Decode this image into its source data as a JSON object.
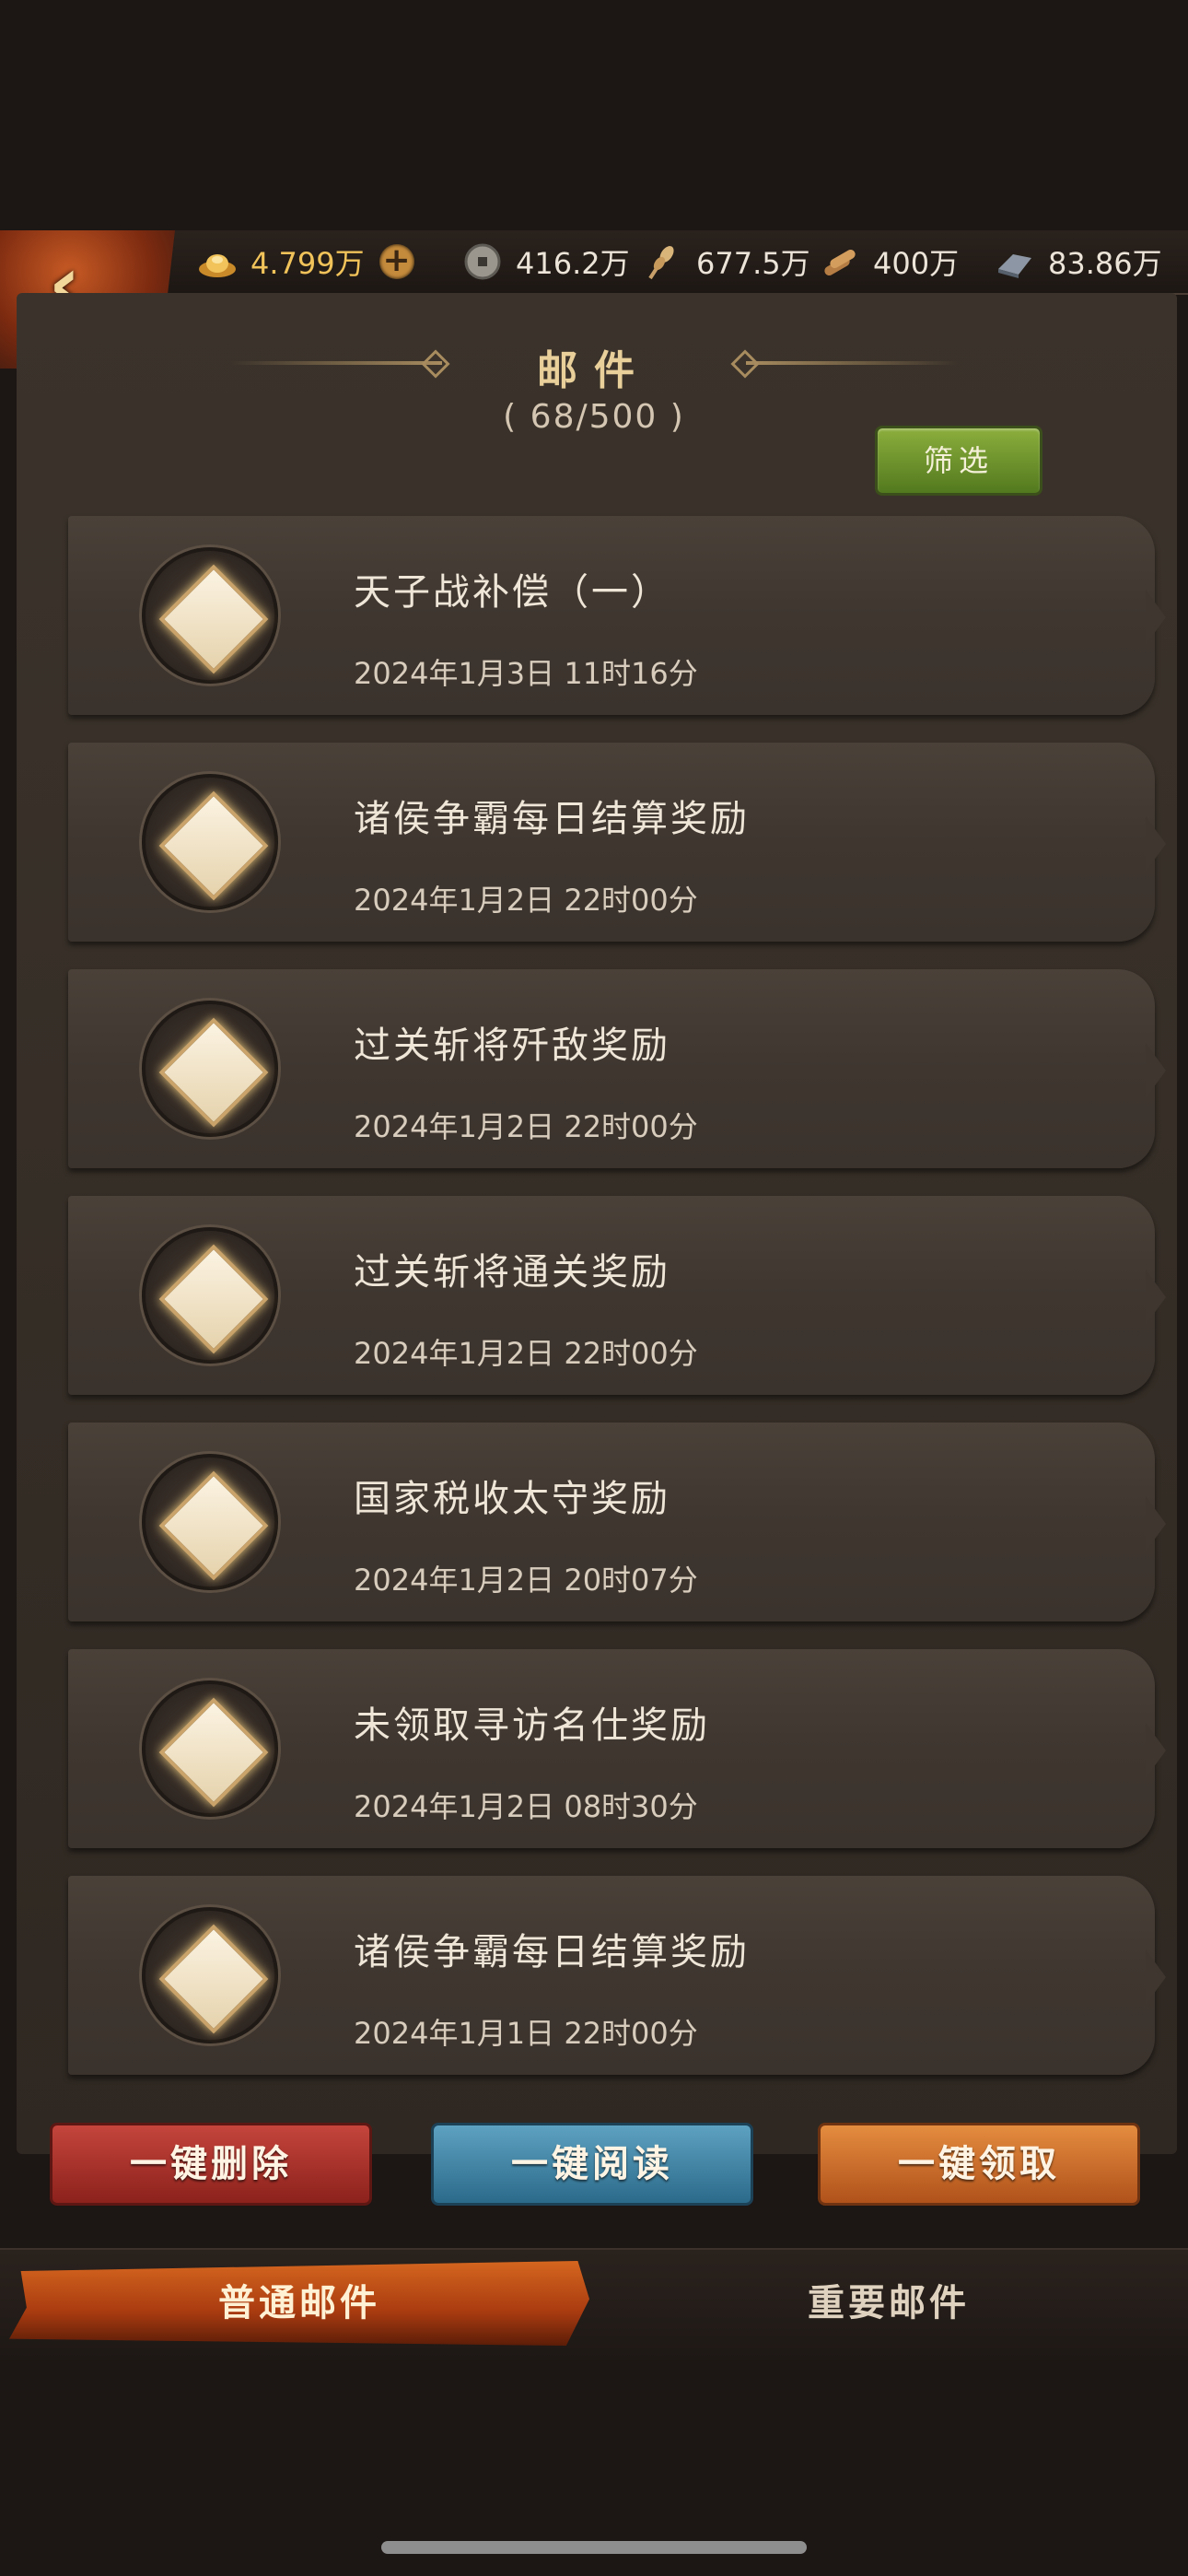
{
  "resources": {
    "gold": "4.799万",
    "coin": "416.2万",
    "grain": "677.5万",
    "wood": "400万",
    "iron": "83.86万"
  },
  "panel": {
    "title": "邮件",
    "count": "( 68/500 )",
    "filter_label": "筛选"
  },
  "mails": [
    {
      "title": "天子战补偿（一）",
      "time": "2024年1月3日 11时16分"
    },
    {
      "title": "诸侯争霸每日结算奖励",
      "time": "2024年1月2日 22时00分"
    },
    {
      "title": "过关斩将歼敌奖励",
      "time": "2024年1月2日 22时00分"
    },
    {
      "title": "过关斩将通关奖励",
      "time": "2024年1月2日 22时00分"
    },
    {
      "title": "国家税收太守奖励",
      "time": "2024年1月2日 20时07分"
    },
    {
      "title": "未领取寻访名仕奖励",
      "time": "2024年1月2日 08时30分"
    },
    {
      "title": "诸侯争霸每日结算奖励",
      "time": "2024年1月1日 22时00分"
    }
  ],
  "actions": {
    "delete_all": "一键删除",
    "read_all": "一键阅读",
    "claim_all": "一键领取"
  },
  "tabs": {
    "normal": "普通邮件",
    "important": "重要邮件"
  }
}
